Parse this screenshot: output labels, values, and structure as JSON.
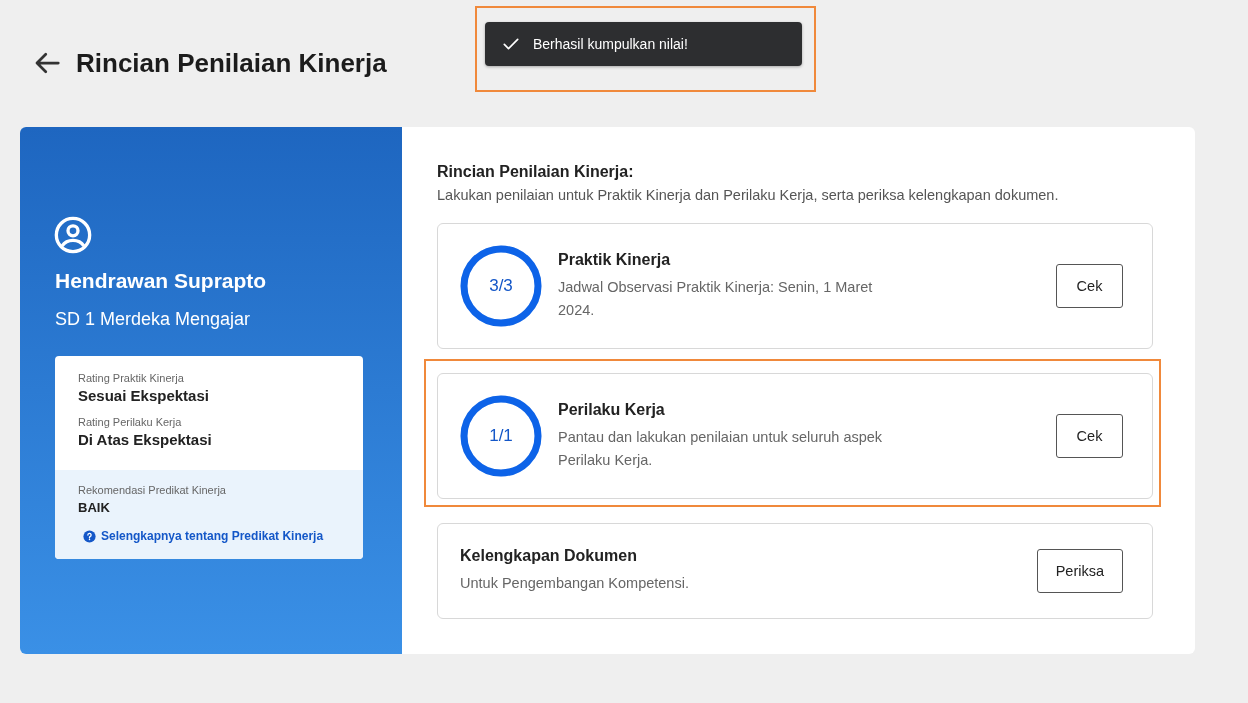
{
  "header": {
    "title": "Rincian Penilaian Kinerja"
  },
  "toast": {
    "message": "Berhasil kumpulkan nilai!",
    "highlighted": true
  },
  "profile": {
    "name": "Hendrawan Suprapto",
    "school": "SD 1 Merdeka Mengajar",
    "ratings": [
      {
        "label": "Rating Praktik Kinerja",
        "value": "Sesuai Ekspektasi"
      },
      {
        "label": "Rating Perilaku Kerja",
        "value": "Di Atas Ekspektasi"
      }
    ],
    "recommendation": {
      "label": "Rekomendasi Predikat Kinerja",
      "value": "BAIK",
      "link": "Selengkapnya tentang Predikat Kinerja"
    }
  },
  "details": {
    "heading": "Rincian Penilaian Kinerja:",
    "description": "Lakukan penilaian untuk Praktik Kinerja dan Perilaku Kerja, serta periksa kelengkapan dokumen.",
    "items": [
      {
        "kind": "progress",
        "count": "3/3",
        "level": 1,
        "title": "Praktik Kinerja",
        "text": "Jadwal Observasi Praktik Kinerja: Senin, 1 Maret 2024.",
        "button": "Cek",
        "highlighted": false
      },
      {
        "kind": "progress",
        "count": "1/1",
        "level": 1,
        "title": "Perilaku Kerja",
        "text": "Pantau dan lakukan penilaian untuk seluruh aspek Perilaku Kerja.",
        "button": "Cek",
        "highlighted": true
      },
      {
        "kind": "plain",
        "title": "Kelengkapan Dokumen",
        "text": "Untuk Pengembangan Kompetensi.",
        "button": "Periksa",
        "highlighted": false
      }
    ]
  }
}
